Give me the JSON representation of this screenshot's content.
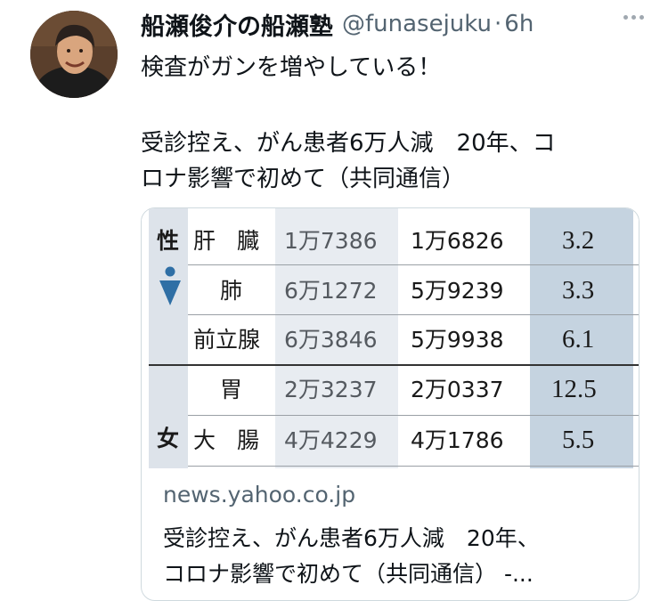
{
  "tweet": {
    "display_name": "船瀬俊介の船瀬塾",
    "handle": "@funasejuku",
    "separator": "·",
    "time": "6h",
    "text_line1": "検査がガンを増やしている！",
    "text_line2": "受診控え、がん患者6万人減　20年、コ",
    "text_line3": "ロナ影響で初めて（共同通信）"
  },
  "card": {
    "table": {
      "group_top_char": "性",
      "group_bottom_char": "女",
      "rows": [
        {
          "organ": "肝臓",
          "prev": "1万7386",
          "curr": "1万6826",
          "ratio": "3.2"
        },
        {
          "organ": "肺",
          "prev": "6万1272",
          "curr": "5万9239",
          "ratio": "3.3"
        },
        {
          "organ": "前立腺",
          "prev": "6万3846",
          "curr": "5万9938",
          "ratio": "6.1"
        },
        {
          "organ": "胃",
          "prev": "2万3237",
          "curr": "2万0337",
          "ratio": "12.5"
        },
        {
          "organ": "大腸",
          "prev": "4万4229",
          "curr": "4万1786",
          "ratio": "5.5"
        }
      ]
    },
    "domain": "news.yahoo.co.jp",
    "title_line1": "受診控え、がん患者6万人減　20年、",
    "title_line2": "コロナ影響で初めて（共同通信） -..."
  },
  "colors": {
    "side_column": "#dde3ea",
    "prev_column": "#e8ecf1",
    "ratio_column": "#c5d3e0",
    "male_icon": "#2f6fa5"
  }
}
